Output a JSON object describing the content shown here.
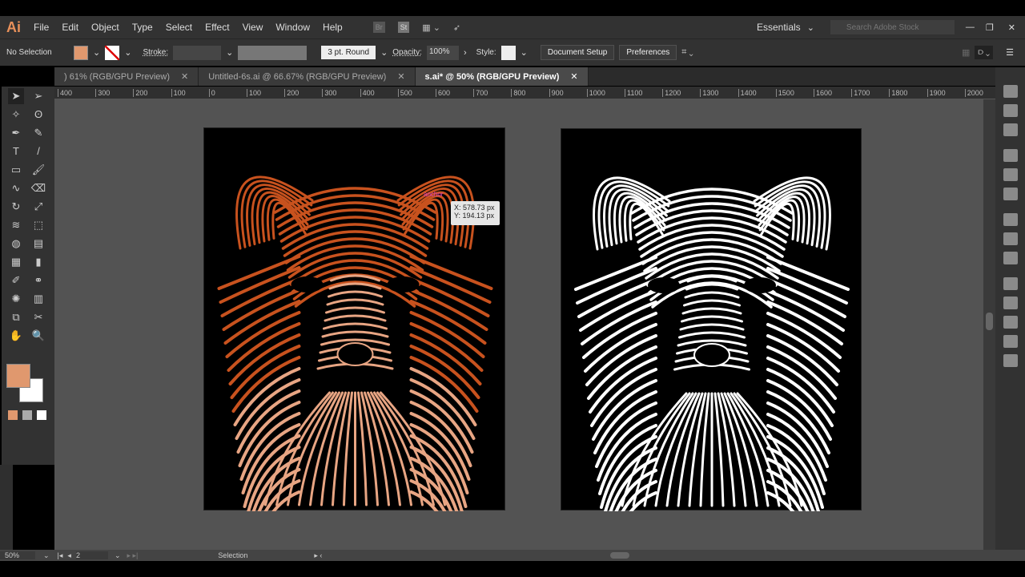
{
  "app": {
    "logo": "Ai",
    "menu": [
      "File",
      "Edit",
      "Object",
      "Type",
      "Select",
      "Effect",
      "View",
      "Window",
      "Help"
    ],
    "bridge": "Br",
    "stock": "St",
    "workspace": "Essentials",
    "search_placeholder": "Search Adobe Stock"
  },
  "control": {
    "selection": "No Selection",
    "fill_color": "#e0986e",
    "stroke_label": "Stroke:",
    "brush": "3 pt. Round",
    "opacity_label": "Opacity:",
    "opacity": "100%",
    "style_label": "Style:",
    "document_setup": "Document Setup",
    "preferences": "Preferences"
  },
  "tabs": [
    {
      "label": ") 61% (RGB/GPU Preview)"
    },
    {
      "label": "Untitled-6s.ai @ 66.67% (RGB/GPU Preview)"
    },
    {
      "label": "s.ai* @ 50% (RGB/GPU Preview)",
      "active": true
    }
  ],
  "ruler": [
    "400",
    "300",
    "200",
    "100",
    "0",
    "100",
    "200",
    "300",
    "400",
    "500",
    "600",
    "700",
    "800",
    "900",
    "1000",
    "1100",
    "1200",
    "1300",
    "1400",
    "1500",
    "1600",
    "1700",
    "1800",
    "1900",
    "2000"
  ],
  "smart_guide": {
    "label": "anchor",
    "x": "X: 578.73 px",
    "y": "Y: 194.13 px"
  },
  "status": {
    "zoom": "50%",
    "artboard": "2",
    "tool": "Selection"
  },
  "colors": {
    "fox_top": "#c8521e",
    "fox_bottom": "#e8a583",
    "accent": "#e8905a"
  }
}
